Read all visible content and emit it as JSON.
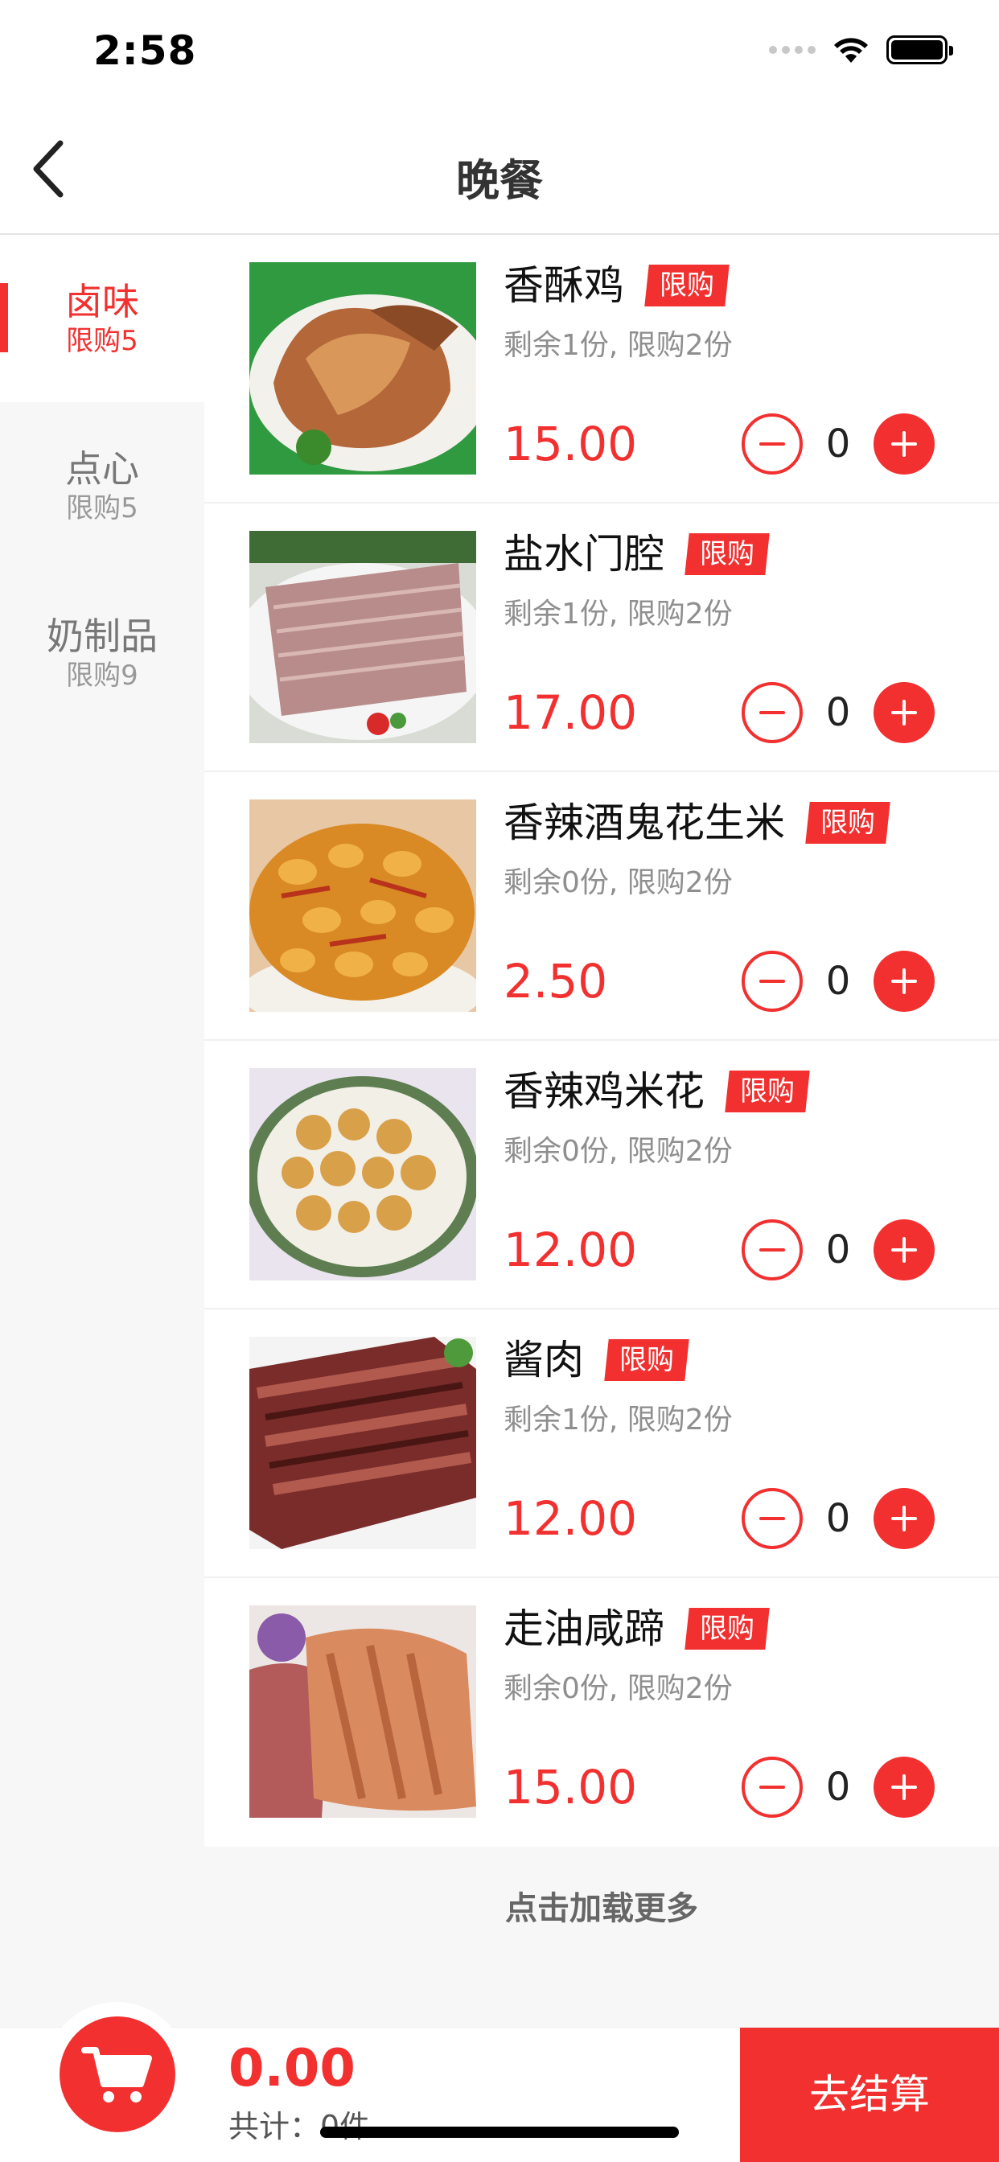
{
  "status_bar": {
    "time": "2:58"
  },
  "nav": {
    "title": "晚餐"
  },
  "sidebar": {
    "items": [
      {
        "name": "卤味",
        "limit": "限购5"
      },
      {
        "name": "点心",
        "limit": "限购5"
      },
      {
        "name": "奶制品",
        "limit": "限购9"
      }
    ]
  },
  "products": [
    {
      "name": "香酥鸡",
      "tag": "限购",
      "stock": "剩余1份, 限购2份",
      "price": "15.00",
      "qty": "0"
    },
    {
      "name": "盐水门腔",
      "tag": "限购",
      "stock": "剩余1份, 限购2份",
      "price": "17.00",
      "qty": "0"
    },
    {
      "name": "香辣酒鬼花生米",
      "tag": "限购",
      "stock": "剩余0份, 限购2份",
      "price": "2.50",
      "qty": "0"
    },
    {
      "name": "香辣鸡米花",
      "tag": "限购",
      "stock": "剩余0份, 限购2份",
      "price": "12.00",
      "qty": "0"
    },
    {
      "name": "酱肉",
      "tag": "限购",
      "stock": "剩余1份, 限购2份",
      "price": "12.00",
      "qty": "0"
    },
    {
      "name": "走油咸蹄",
      "tag": "限购",
      "stock": "剩余0份, 限购2份",
      "price": "15.00",
      "qty": "0"
    }
  ],
  "load_more": "点击加载更多",
  "cart": {
    "total": "0.00",
    "count": "共计：0件",
    "checkout": "去结算"
  },
  "colors": {
    "accent": "#f23030",
    "sidebar_bg": "#f7f7f7"
  },
  "icons": {
    "back": "chevron-left-icon",
    "cart": "shopping-cart-icon",
    "minus": "minus-circle-icon",
    "plus": "plus-circle-icon"
  }
}
